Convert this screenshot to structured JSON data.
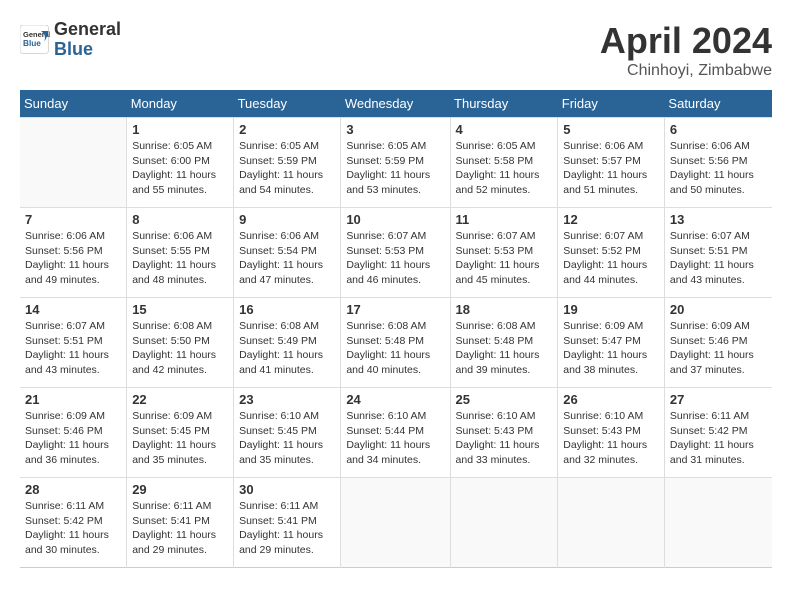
{
  "header": {
    "logo": {
      "general": "General",
      "blue": "Blue"
    },
    "title": "April 2024",
    "location": "Chinhoyi, Zimbabwe"
  },
  "weekdays": [
    "Sunday",
    "Monday",
    "Tuesday",
    "Wednesday",
    "Thursday",
    "Friday",
    "Saturday"
  ],
  "weeks": [
    [
      {
        "day": "",
        "sunrise": "",
        "sunset": "",
        "daylight": ""
      },
      {
        "day": "1",
        "sunrise": "Sunrise: 6:05 AM",
        "sunset": "Sunset: 6:00 PM",
        "daylight": "Daylight: 11 hours and 55 minutes."
      },
      {
        "day": "2",
        "sunrise": "Sunrise: 6:05 AM",
        "sunset": "Sunset: 5:59 PM",
        "daylight": "Daylight: 11 hours and 54 minutes."
      },
      {
        "day": "3",
        "sunrise": "Sunrise: 6:05 AM",
        "sunset": "Sunset: 5:59 PM",
        "daylight": "Daylight: 11 hours and 53 minutes."
      },
      {
        "day": "4",
        "sunrise": "Sunrise: 6:05 AM",
        "sunset": "Sunset: 5:58 PM",
        "daylight": "Daylight: 11 hours and 52 minutes."
      },
      {
        "day": "5",
        "sunrise": "Sunrise: 6:06 AM",
        "sunset": "Sunset: 5:57 PM",
        "daylight": "Daylight: 11 hours and 51 minutes."
      },
      {
        "day": "6",
        "sunrise": "Sunrise: 6:06 AM",
        "sunset": "Sunset: 5:56 PM",
        "daylight": "Daylight: 11 hours and 50 minutes."
      }
    ],
    [
      {
        "day": "7",
        "sunrise": "Sunrise: 6:06 AM",
        "sunset": "Sunset: 5:56 PM",
        "daylight": "Daylight: 11 hours and 49 minutes."
      },
      {
        "day": "8",
        "sunrise": "Sunrise: 6:06 AM",
        "sunset": "Sunset: 5:55 PM",
        "daylight": "Daylight: 11 hours and 48 minutes."
      },
      {
        "day": "9",
        "sunrise": "Sunrise: 6:06 AM",
        "sunset": "Sunset: 5:54 PM",
        "daylight": "Daylight: 11 hours and 47 minutes."
      },
      {
        "day": "10",
        "sunrise": "Sunrise: 6:07 AM",
        "sunset": "Sunset: 5:53 PM",
        "daylight": "Daylight: 11 hours and 46 minutes."
      },
      {
        "day": "11",
        "sunrise": "Sunrise: 6:07 AM",
        "sunset": "Sunset: 5:53 PM",
        "daylight": "Daylight: 11 hours and 45 minutes."
      },
      {
        "day": "12",
        "sunrise": "Sunrise: 6:07 AM",
        "sunset": "Sunset: 5:52 PM",
        "daylight": "Daylight: 11 hours and 44 minutes."
      },
      {
        "day": "13",
        "sunrise": "Sunrise: 6:07 AM",
        "sunset": "Sunset: 5:51 PM",
        "daylight": "Daylight: 11 hours and 43 minutes."
      }
    ],
    [
      {
        "day": "14",
        "sunrise": "Sunrise: 6:07 AM",
        "sunset": "Sunset: 5:51 PM",
        "daylight": "Daylight: 11 hours and 43 minutes."
      },
      {
        "day": "15",
        "sunrise": "Sunrise: 6:08 AM",
        "sunset": "Sunset: 5:50 PM",
        "daylight": "Daylight: 11 hours and 42 minutes."
      },
      {
        "day": "16",
        "sunrise": "Sunrise: 6:08 AM",
        "sunset": "Sunset: 5:49 PM",
        "daylight": "Daylight: 11 hours and 41 minutes."
      },
      {
        "day": "17",
        "sunrise": "Sunrise: 6:08 AM",
        "sunset": "Sunset: 5:48 PM",
        "daylight": "Daylight: 11 hours and 40 minutes."
      },
      {
        "day": "18",
        "sunrise": "Sunrise: 6:08 AM",
        "sunset": "Sunset: 5:48 PM",
        "daylight": "Daylight: 11 hours and 39 minutes."
      },
      {
        "day": "19",
        "sunrise": "Sunrise: 6:09 AM",
        "sunset": "Sunset: 5:47 PM",
        "daylight": "Daylight: 11 hours and 38 minutes."
      },
      {
        "day": "20",
        "sunrise": "Sunrise: 6:09 AM",
        "sunset": "Sunset: 5:46 PM",
        "daylight": "Daylight: 11 hours and 37 minutes."
      }
    ],
    [
      {
        "day": "21",
        "sunrise": "Sunrise: 6:09 AM",
        "sunset": "Sunset: 5:46 PM",
        "daylight": "Daylight: 11 hours and 36 minutes."
      },
      {
        "day": "22",
        "sunrise": "Sunrise: 6:09 AM",
        "sunset": "Sunset: 5:45 PM",
        "daylight": "Daylight: 11 hours and 35 minutes."
      },
      {
        "day": "23",
        "sunrise": "Sunrise: 6:10 AM",
        "sunset": "Sunset: 5:45 PM",
        "daylight": "Daylight: 11 hours and 35 minutes."
      },
      {
        "day": "24",
        "sunrise": "Sunrise: 6:10 AM",
        "sunset": "Sunset: 5:44 PM",
        "daylight": "Daylight: 11 hours and 34 minutes."
      },
      {
        "day": "25",
        "sunrise": "Sunrise: 6:10 AM",
        "sunset": "Sunset: 5:43 PM",
        "daylight": "Daylight: 11 hours and 33 minutes."
      },
      {
        "day": "26",
        "sunrise": "Sunrise: 6:10 AM",
        "sunset": "Sunset: 5:43 PM",
        "daylight": "Daylight: 11 hours and 32 minutes."
      },
      {
        "day": "27",
        "sunrise": "Sunrise: 6:11 AM",
        "sunset": "Sunset: 5:42 PM",
        "daylight": "Daylight: 11 hours and 31 minutes."
      }
    ],
    [
      {
        "day": "28",
        "sunrise": "Sunrise: 6:11 AM",
        "sunset": "Sunset: 5:42 PM",
        "daylight": "Daylight: 11 hours and 30 minutes."
      },
      {
        "day": "29",
        "sunrise": "Sunrise: 6:11 AM",
        "sunset": "Sunset: 5:41 PM",
        "daylight": "Daylight: 11 hours and 29 minutes."
      },
      {
        "day": "30",
        "sunrise": "Sunrise: 6:11 AM",
        "sunset": "Sunset: 5:41 PM",
        "daylight": "Daylight: 11 hours and 29 minutes."
      },
      {
        "day": "",
        "sunrise": "",
        "sunset": "",
        "daylight": ""
      },
      {
        "day": "",
        "sunrise": "",
        "sunset": "",
        "daylight": ""
      },
      {
        "day": "",
        "sunrise": "",
        "sunset": "",
        "daylight": ""
      },
      {
        "day": "",
        "sunrise": "",
        "sunset": "",
        "daylight": ""
      }
    ]
  ]
}
